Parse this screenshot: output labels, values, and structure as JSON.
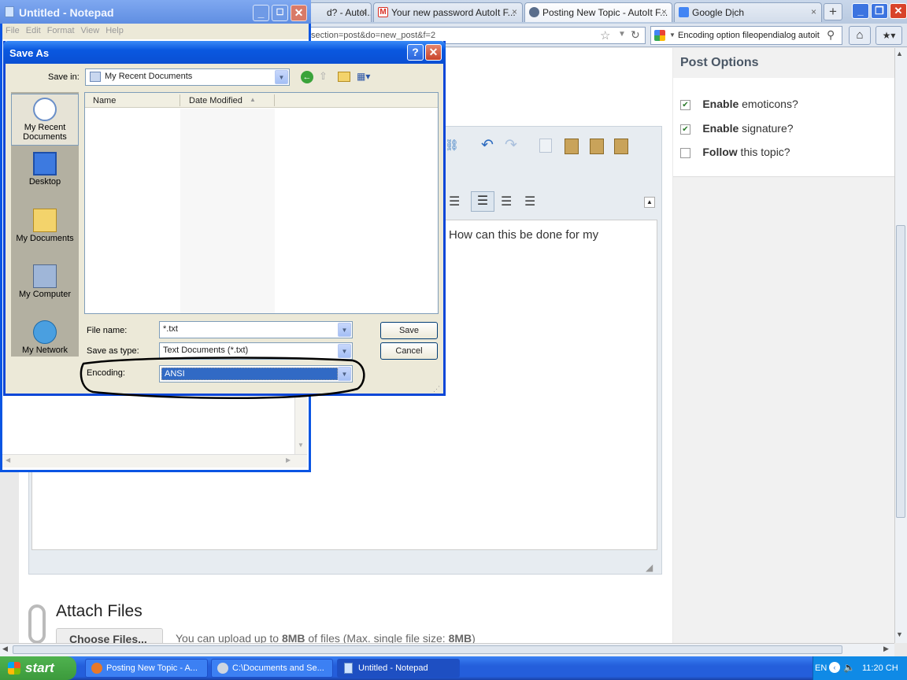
{
  "browser": {
    "tabs": [
      {
        "label": "d? - AutoI...",
        "icon_color": "#6a8fc8"
      },
      {
        "label": "Your new password AutoIt F...",
        "icon_color": "#d93025"
      },
      {
        "label": "Posting New Topic - AutoIt F...",
        "icon_color": "#5a6e8c"
      },
      {
        "label": "Google Dịch",
        "icon_color": "#4285f4"
      }
    ],
    "new_tab": "+",
    "url": "section=post&do=new_post&f=2",
    "search_text": "Encoding option fileopendialog autoit"
  },
  "post_options": {
    "title": "Post Options",
    "items": [
      {
        "bold": "Enable",
        "rest": " emoticons?",
        "checked": true
      },
      {
        "bold": "Enable",
        "rest": " signature?",
        "checked": true
      },
      {
        "bold": "Follow",
        "rest": " this topic?",
        "checked": false
      }
    ]
  },
  "editor": {
    "text": "How can this be done for my"
  },
  "attach": {
    "title": "Attach Files",
    "button": "Choose Files...",
    "info_pre": "You can upload up to ",
    "info_bold1": "8MB",
    "info_mid": " of files (Max. single file size: ",
    "info_bold2": "8MB",
    "info_end": ")"
  },
  "notepad": {
    "title": "Untitled - Notepad",
    "menu": [
      "File",
      "Edit",
      "Format",
      "View",
      "Help"
    ]
  },
  "save_dialog": {
    "title": "Save As",
    "help": "?",
    "close": "✕",
    "save_in_label": "Save in:",
    "save_in_value": "My Recent Documents",
    "places": [
      {
        "line1": "My Recent",
        "line2": "Documents"
      },
      {
        "line1": "Desktop",
        "line2": ""
      },
      {
        "line1": "My Documents",
        "line2": ""
      },
      {
        "line1": "My Computer",
        "line2": ""
      },
      {
        "line1": "My Network",
        "line2": ""
      }
    ],
    "col_name": "Name",
    "col_date": "Date Modified",
    "file_name_label": "File name:",
    "file_name_value": "*.txt",
    "save_type_label": "Save as type:",
    "save_type_value": "Text Documents (*.txt)",
    "encoding_label": "Encoding:",
    "encoding_value": "ANSI",
    "save_button": "Save",
    "cancel_button": "Cancel"
  },
  "taskbar": {
    "start": "start",
    "tasks": [
      "Posting New Topic - A...",
      "C:\\Documents and Se...",
      "Untitled - Notepad"
    ],
    "lang": "EN",
    "time": "11:20 CH"
  }
}
